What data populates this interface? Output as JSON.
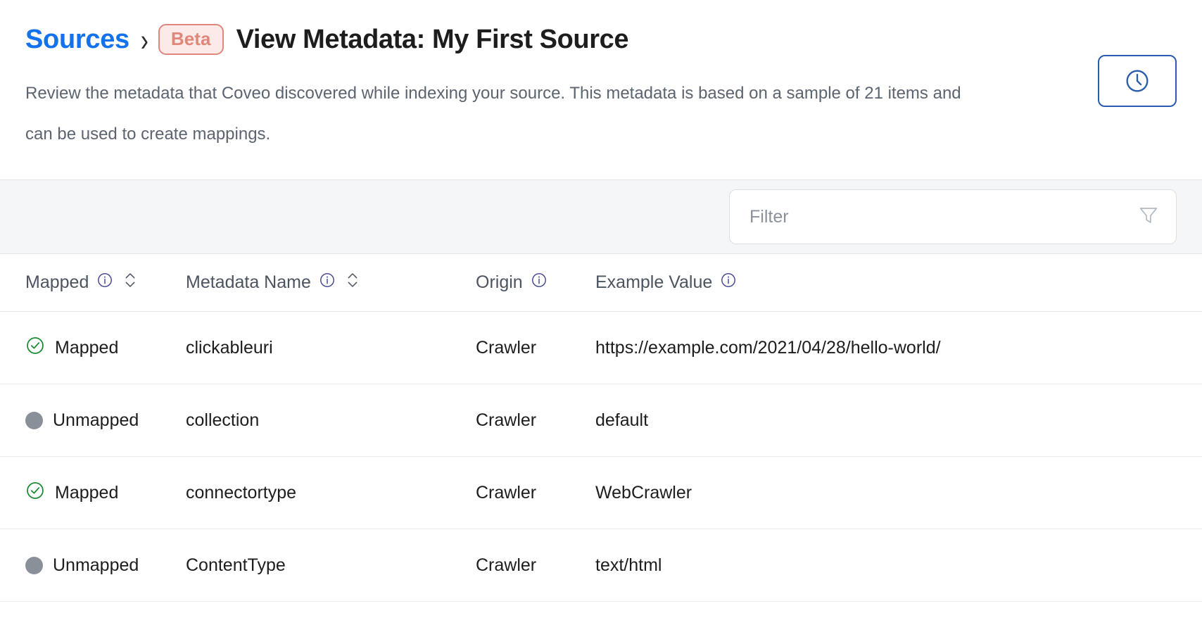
{
  "header": {
    "breadcrumb_link": "Sources",
    "breadcrumb_separator": "›",
    "beta_badge": "Beta",
    "page_title": "View Metadata: My First Source",
    "subtitle": "Review the metadata that Coveo discovered while indexing your source. This metadata is based on a sample of 21 items and can be used to create mappings.",
    "history_button_icon": "clock-icon",
    "link_color": "#1372ec",
    "beta_border_color": "#e0877c",
    "beta_bg_color": "#fbeae8",
    "history_border_color": "#2b5bad"
  },
  "filter": {
    "placeholder": "Filter",
    "value": "",
    "icon": "funnel-icon"
  },
  "table": {
    "columns": [
      {
        "label": "Mapped",
        "info": "info-icon",
        "sortable": true
      },
      {
        "label": "Metadata Name",
        "info": "info-icon",
        "sortable": true
      },
      {
        "label": "Origin",
        "info": "info-icon",
        "sortable": false
      },
      {
        "label": "Example Value",
        "info": "info-icon",
        "sortable": false
      }
    ],
    "rows": [
      {
        "status": "Mapped",
        "status_icon": "check-circle-icon",
        "name": "clickableuri",
        "origin": "Crawler",
        "value": "https://example.com/2021/04/28/hello-world/"
      },
      {
        "status": "Unmapped",
        "status_icon": "gray-dot-icon",
        "name": "collection",
        "origin": "Crawler",
        "value": "default"
      },
      {
        "status": "Mapped",
        "status_icon": "check-circle-icon",
        "name": "connectortype",
        "origin": "Crawler",
        "value": "WebCrawler"
      },
      {
        "status": "Unmapped",
        "status_icon": "gray-dot-icon",
        "name": "ContentType",
        "origin": "Crawler",
        "value": "text/html"
      }
    ],
    "mapped_color": "#1a8a33",
    "unmapped_color": "#8a9099"
  }
}
